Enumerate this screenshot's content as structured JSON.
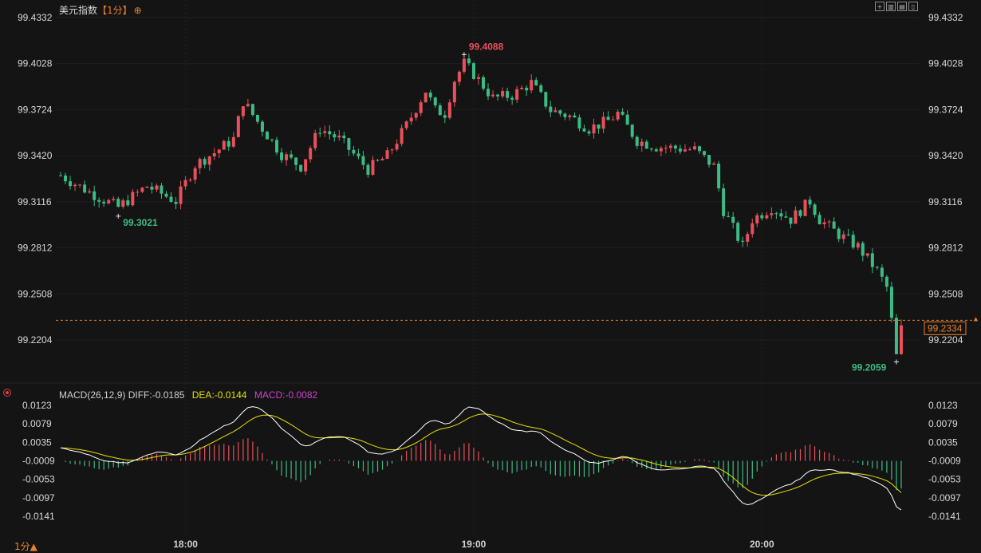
{
  "header": {
    "instrument": "美元指数",
    "period": "【1分】",
    "expand_icon": "⊕",
    "toolbar_icons": [
      "crosshair-icon",
      "chart-type-icon",
      "indicator-icon",
      "collapse-icon"
    ]
  },
  "price_axis": {
    "ticks": [
      "99.4332",
      "99.4028",
      "99.3724",
      "99.3420",
      "99.3116",
      "99.2812",
      "99.2508",
      "99.2204"
    ],
    "current_price_label": "99.2334"
  },
  "macd_axis": {
    "ticks": [
      "0.0123",
      "0.0079",
      "0.0035",
      "-0.0009",
      "-0.0053",
      "-0.0097",
      "-0.0141"
    ]
  },
  "time_axis": {
    "ticks": [
      "18:00",
      "19:00",
      "20:00"
    ]
  },
  "macd_legend": {
    "params": "MACD(26,12,9)",
    "diff": "DIFF:-0.0185",
    "dea": "DEA:-0.0144",
    "macd": "MACD:-0.0082"
  },
  "period_selector": "1分▲",
  "colors": {
    "up": "#e8505b",
    "down": "#3dbb84",
    "dea": "#e8e200",
    "diff": "#ffffff",
    "accent": "#e8822c"
  },
  "chart_data": {
    "type": "candlestick",
    "interval": "1 minute",
    "y_range": [
      99.2,
      99.4332
    ],
    "current_price": 99.2334,
    "annotations": [
      {
        "label": "99.4088",
        "time": "18:58",
        "type": "high"
      },
      {
        "label": "99.3021",
        "time": "17:46",
        "type": "low"
      },
      {
        "label": "99.2059",
        "time": "20:28",
        "type": "low"
      }
    ],
    "close_anchors": [
      [
        "17:34",
        99.329
      ],
      [
        "17:40",
        99.318
      ],
      [
        "17:46",
        99.308
      ],
      [
        "17:52",
        99.322
      ],
      [
        "17:58",
        99.312
      ],
      [
        "18:02",
        99.336
      ],
      [
        "18:06",
        99.344
      ],
      [
        "18:10",
        99.353
      ],
      [
        "18:12",
        99.378
      ],
      [
        "18:16",
        99.36
      ],
      [
        "18:20",
        99.343
      ],
      [
        "18:24",
        99.335
      ],
      [
        "18:28",
        99.36
      ],
      [
        "18:32",
        99.353
      ],
      [
        "18:38",
        99.333
      ],
      [
        "18:42",
        99.342
      ],
      [
        "18:46",
        99.362
      ],
      [
        "18:50",
        99.385
      ],
      [
        "18:52",
        99.372
      ],
      [
        "18:54",
        99.37
      ],
      [
        "18:56",
        99.392
      ],
      [
        "18:58",
        99.403
      ],
      [
        "19:00",
        99.396
      ],
      [
        "19:04",
        99.38
      ],
      [
        "19:08",
        99.382
      ],
      [
        "19:12",
        99.39
      ],
      [
        "19:16",
        99.372
      ],
      [
        "19:20",
        99.368
      ],
      [
        "19:24",
        99.36
      ],
      [
        "19:28",
        99.365
      ],
      [
        "19:30",
        99.37
      ],
      [
        "19:34",
        99.352
      ],
      [
        "19:38",
        99.348
      ],
      [
        "19:42",
        99.347
      ],
      [
        "19:46",
        99.346
      ],
      [
        "19:50",
        99.335
      ],
      [
        "19:52",
        99.306
      ],
      [
        "19:56",
        99.282
      ],
      [
        "19:58",
        99.3
      ],
      [
        "20:02",
        99.308
      ],
      [
        "20:06",
        99.3
      ],
      [
        "20:10",
        99.312
      ],
      [
        "20:12",
        99.3
      ],
      [
        "20:16",
        99.29
      ],
      [
        "20:20",
        99.282
      ],
      [
        "20:24",
        99.266
      ],
      [
        "20:26",
        99.255
      ],
      [
        "20:28",
        99.211
      ],
      [
        "20:29",
        99.23
      ]
    ],
    "macd_series": [
      {
        "name": "DIFF",
        "y_range": [
          -0.0185,
          0.0123
        ]
      },
      {
        "name": "DEA",
        "y_range": [
          -0.0144,
          0.0123
        ]
      },
      {
        "name": "MACD",
        "y_range": [
          -0.0082,
          0.0123
        ]
      }
    ]
  }
}
